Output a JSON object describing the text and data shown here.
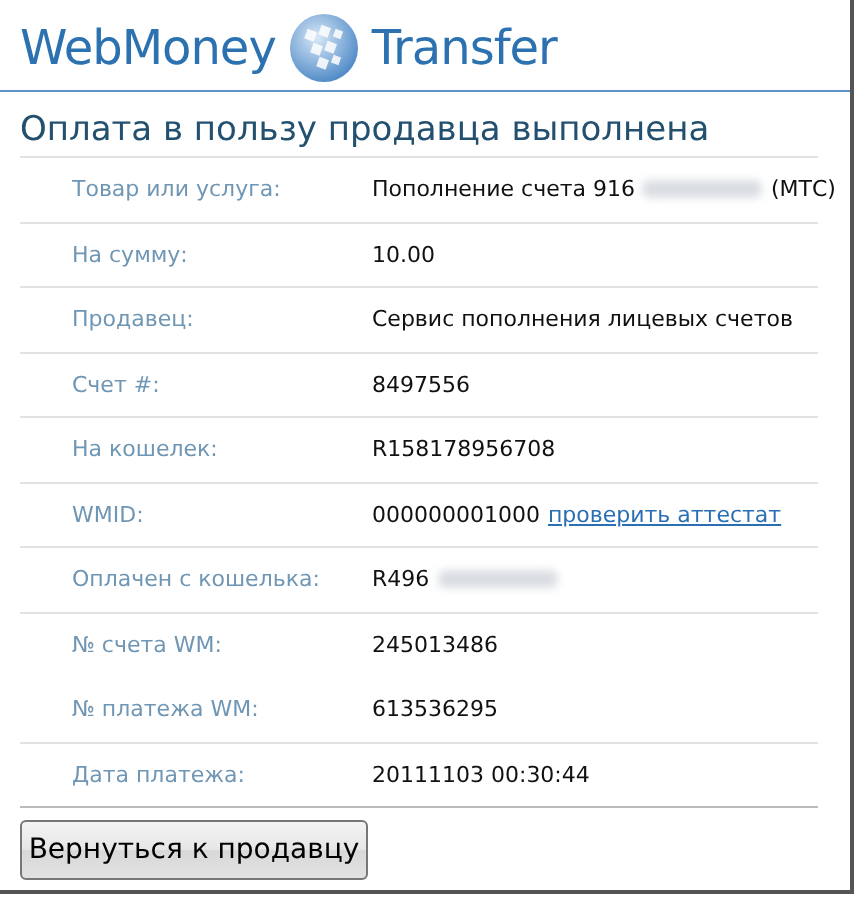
{
  "logo": {
    "word_left": "WebMoney",
    "word_right": "Transfer"
  },
  "heading": "Оплата в пользу продавца выполнена",
  "rows": [
    {
      "label": "Товар или услуга:",
      "value": "Пополнение счета 916",
      "redacted": true,
      "suffix": "(МТС)",
      "divider": true
    },
    {
      "label": "На сумму:",
      "value": "10.00",
      "redacted": false,
      "divider": true
    },
    {
      "label": "Продавец:",
      "value": "Сервис пополнения лицевых счетов",
      "redacted": false,
      "divider": true
    },
    {
      "label": "Счет #:",
      "value": "8497556",
      "redacted": false,
      "divider": true
    },
    {
      "label": "На кошелек:",
      "value": "R158178956708",
      "redacted": false,
      "divider": true
    },
    {
      "label": "WMID:",
      "value": "000000001000",
      "redacted": false,
      "link": "проверить аттестат",
      "divider": true
    },
    {
      "label": "Оплачен с кошелька:",
      "value": "R496",
      "redacted": true,
      "divider": true
    },
    {
      "label": "№ счета WM:",
      "value": "245013486",
      "redacted": false,
      "divider": false
    },
    {
      "label": "№ платежа WM:",
      "value": "613536295",
      "redacted": false,
      "divider": true
    },
    {
      "label": "Дата платежа:",
      "value": "20111103 00:30:44",
      "redacted": false,
      "divider": true
    }
  ],
  "button": "Вернуться к продавцу"
}
